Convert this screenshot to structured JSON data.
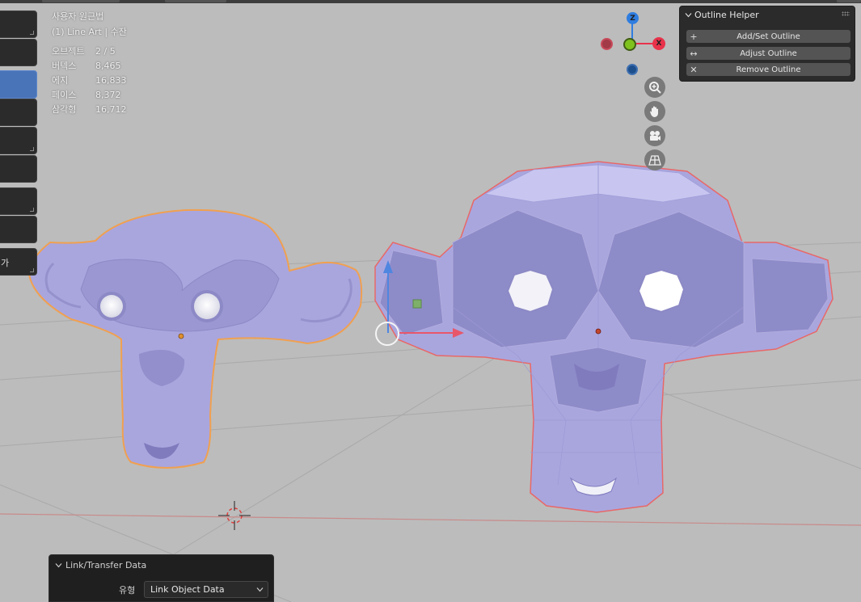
{
  "overlay": {
    "view_mode": "사용자 원근법",
    "collection": "(1) Line Art | 수잔",
    "stats": [
      {
        "key": "오브젝트",
        "value": "2 / 5"
      },
      {
        "key": "버텍스",
        "value": "8,465"
      },
      {
        "key": "에지",
        "value": "16,833"
      },
      {
        "key": "페이스",
        "value": "8,372"
      },
      {
        "key": "삼각형",
        "value": "16,712"
      }
    ]
  },
  "left_panel": {
    "cut_text": "가"
  },
  "gizmo": {
    "z": "Z",
    "x": "X",
    "colors": {
      "x": "#e8324a",
      "y": "#7fc21e",
      "z": "#2f7de0"
    }
  },
  "outline_helper": {
    "title": "Outline Helper",
    "buttons": [
      {
        "icon": "plus-icon",
        "glyph": "+",
        "label": "Add/Set Outline"
      },
      {
        "icon": "arrows-horizontal-icon",
        "glyph": "↔",
        "label": "Adjust Outline"
      },
      {
        "icon": "x-icon",
        "glyph": "✕",
        "label": "Remove Outline"
      }
    ]
  },
  "last_operator": {
    "title": "Link/Transfer Data",
    "field_label": "유형",
    "field_value": "Link Object Data"
  }
}
